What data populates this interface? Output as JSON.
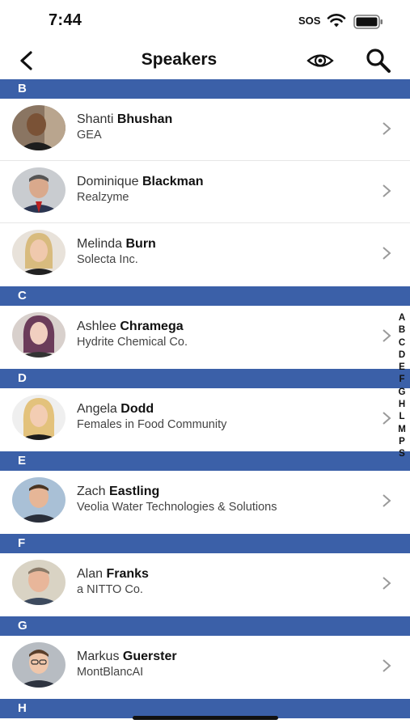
{
  "status_bar": {
    "time": "7:44",
    "sos": "SOS"
  },
  "nav": {
    "title": "Speakers"
  },
  "sections": [
    {
      "letter": "B",
      "speakers": [
        {
          "first": "Shanti",
          "last": "Bhushan",
          "company": "GEA"
        },
        {
          "first": "Dominique",
          "last": "Blackman",
          "company": "Realzyme"
        },
        {
          "first": "Melinda",
          "last": "Burn",
          "company": "Solecta Inc."
        }
      ]
    },
    {
      "letter": "C",
      "speakers": [
        {
          "first": "Ashlee",
          "last": "Chramega",
          "company": "Hydrite Chemical Co."
        }
      ]
    },
    {
      "letter": "D",
      "speakers": [
        {
          "first": "Angela",
          "last": "Dodd",
          "company": "Females in Food Community"
        }
      ]
    },
    {
      "letter": "E",
      "speakers": [
        {
          "first": "Zach",
          "last": "Eastling",
          "company": "Veolia Water Technologies & Solutions"
        }
      ]
    },
    {
      "letter": "F",
      "speakers": [
        {
          "first": "Alan",
          "last": "Franks",
          "company": "a NITTO Co."
        }
      ]
    },
    {
      "letter": "G",
      "speakers": [
        {
          "first": "Markus",
          "last": "Guerster",
          "company": "MontBlancAI"
        }
      ]
    },
    {
      "letter": "H",
      "speakers": []
    }
  ],
  "alpha_index": [
    "A",
    "B",
    "C",
    "D",
    "E",
    "F",
    "G",
    "H",
    "L",
    "M",
    "P",
    "S"
  ],
  "colors": {
    "section_header": "#3b60a8",
    "accent_text": "#111111"
  }
}
